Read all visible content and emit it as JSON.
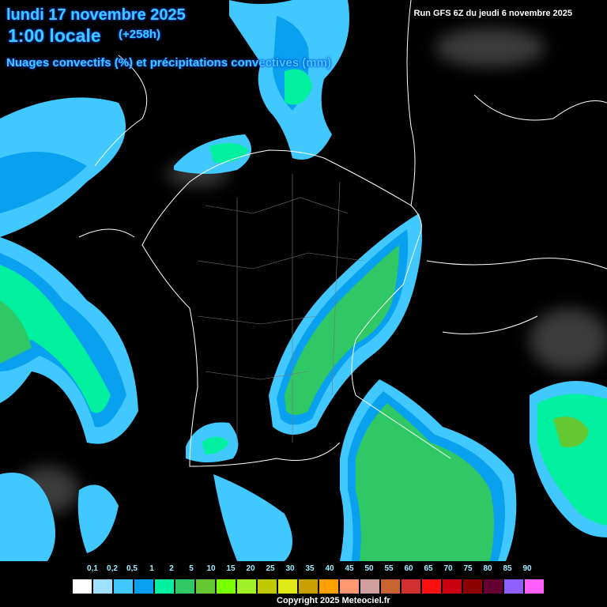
{
  "header": {
    "date": "lundi 17 novembre 2025",
    "local_time": "1:00 locale",
    "lead_time": "(+258h)",
    "parameter": "Nuages convectifs (%) et précipitations convectives (mm)",
    "run": "Run GFS 6Z du jeudi 6 novembre 2025"
  },
  "legend": {
    "labels": [
      "0,1",
      "0,2",
      "0,5",
      "1",
      "2",
      "5",
      "10",
      "15",
      "20",
      "25",
      "30",
      "35",
      "40",
      "45",
      "50",
      "55",
      "60",
      "65",
      "70",
      "75",
      "80",
      "85",
      "90"
    ],
    "colors": [
      "#ffffff",
      "#a0e0ff",
      "#40c8ff",
      "#0aa0f0",
      "#00f0a0",
      "#30c864",
      "#64c832",
      "#78ff00",
      "#a0f028",
      "#c0c800",
      "#e0e818",
      "#c8a000",
      "#ffa000",
      "#ff9870",
      "#d0a0a0",
      "#c86432",
      "#d03030",
      "#ff1010",
      "#c80010",
      "#8c0000",
      "#640032",
      "#9060ff",
      "#ff60ff"
    ]
  },
  "copyright": "Copyright 2025 Meteociel.fr"
}
